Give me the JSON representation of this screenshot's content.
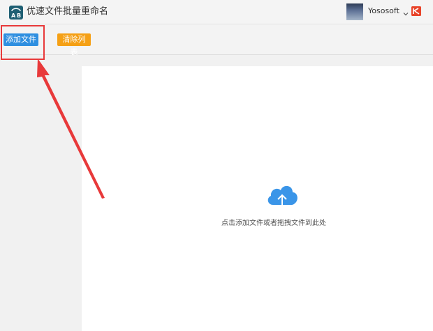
{
  "app": {
    "title": "优速文件批量重命名",
    "logo_icon": "ab-rename-app-icon"
  },
  "user": {
    "name": "Yososoft",
    "dropdown_icon": "chevron-down-icon",
    "brand_icon": "yososoft-logo-icon"
  },
  "toolbar": {
    "add_label": "添加文件",
    "clear_label": "清除列表"
  },
  "drop_area": {
    "hint": "点击添加文件或者拖拽文件到此处",
    "icon": "cloud-upload-icon"
  },
  "colors": {
    "add_button": "#2f8fe0",
    "clear_button": "#f5a015",
    "annotation": "#e8393a",
    "cloud": "#3a95e8"
  }
}
